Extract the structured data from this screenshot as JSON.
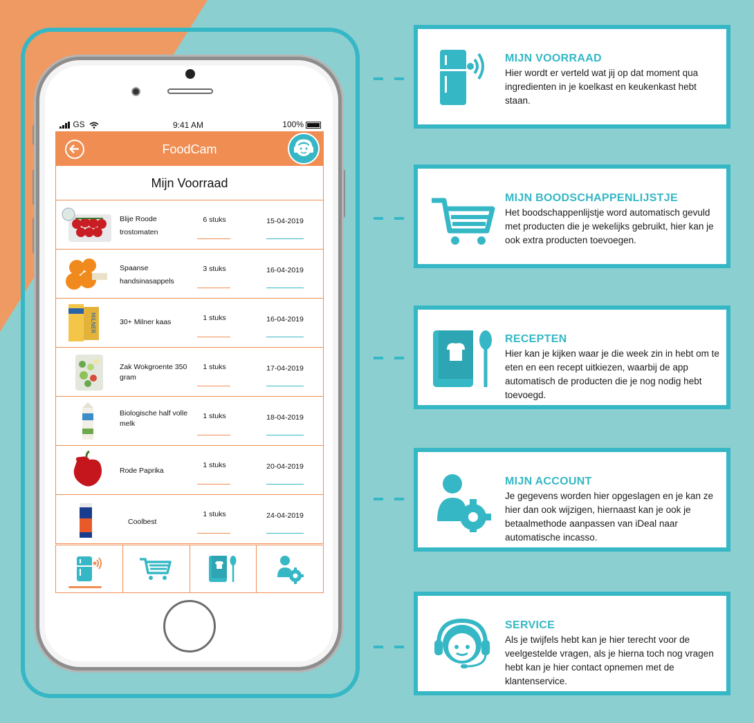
{
  "colors": {
    "orange": "#ef8d52",
    "teal": "#35b7c5",
    "background": "#8ccfd0"
  },
  "phone": {
    "status": {
      "carrier": "GS",
      "time": "9:41 AM",
      "battery": "100%"
    },
    "app_title": "FoodCam",
    "list_title": "Mijn Voorraad",
    "rows": [
      {
        "name": "Blije Roode trostomaten",
        "qty": "6 stuks",
        "date": "15-04-2019",
        "image": "tomatoes"
      },
      {
        "name": "Spaanse handsinasappels",
        "qty": "3 stuks",
        "date": "16-04-2019",
        "image": "oranges"
      },
      {
        "name": "30+ Milner kaas",
        "qty": "1 stuks",
        "date": "16-04-2019",
        "image": "cheese"
      },
      {
        "name": "Zak Wokgroente 350 gram",
        "qty": "1 stuks",
        "date": "17-04-2019",
        "image": "vegetables"
      },
      {
        "name": "Biologische half volle melk",
        "qty": "1 stuks",
        "date": "18-04-2019",
        "image": "milk"
      },
      {
        "name": "Rode Paprika",
        "qty": "1 stuks",
        "date": "20-04-2019",
        "image": "pepper"
      },
      {
        "name": "Coolbest",
        "qty": "1 stuks",
        "date": "24-04-2019",
        "image": "juice"
      }
    ],
    "tabs": [
      "fridge-icon",
      "cart-icon",
      "recipe-book-icon",
      "account-icon"
    ],
    "active_tab": 0
  },
  "features": [
    {
      "title": "MIJN VOORRAAD",
      "icon": "fridge-icon",
      "text": "Hier wordt er verteld wat jij op dat moment qua ingredienten in je koelkast en keukenkast hebt staan."
    },
    {
      "title": "MIJN BOODSCHAPPENLIJSTJE",
      "icon": "cart-icon",
      "text": "Het boodschappenlijstje word automatisch gevuld met producten die je wekelijks gebruikt, hier kan je ook extra producten toevoegen."
    },
    {
      "title": "RECEPTEN",
      "icon": "recipe-book-icon",
      "text": "Hier kan je kijken waar je die week zin in hebt om te eten en een recept uitkiezen, waarbij de app automatisch de producten die je nog nodig hebt toevoegd."
    },
    {
      "title": "MIJN ACCOUNT",
      "icon": "account-icon",
      "text": "Je gegevens worden hier opgeslagen en je kan ze hier dan ook wijzigen, hiernaast kan je ook je betaalmethode aanpassen van iDeal naar automatische incasso."
    },
    {
      "title": "SERVICE",
      "icon": "headset-icon",
      "text": "Als je twijfels hebt kan je hier terecht voor de veelgestelde vragen, als je hierna toch nog vragen hebt kan je hier contact opnemen met de klantenservice."
    }
  ]
}
